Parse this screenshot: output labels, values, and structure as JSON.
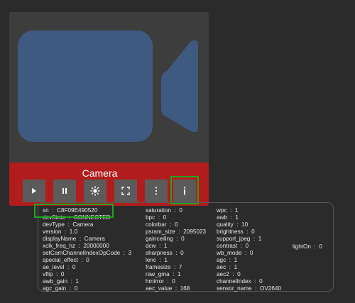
{
  "camera": {
    "title": "Camera"
  },
  "controls": {
    "play": "play-icon",
    "pause": "pause-icon",
    "brightness": "brightness-icon",
    "fullscreen": "fullscreen-icon",
    "menu": "more-vertical-icon",
    "info": "info-icon"
  },
  "info": {
    "columns": [
      [
        "sn  :  C8F09E490520",
        "devState  :  CONNECTED",
        "devType  :  Camera",
        "version  :  1.0",
        "displayName  :  Camera",
        "xclk_freq_hz  :  20000000",
        "setCamChannelIndexOpCode  :  3",
        "special_effect  :  0",
        "ae_level  :  0",
        "vflip  :  0",
        "awb_gain  :  1",
        "agc_gain  :  0"
      ],
      [
        "saturation  :  0",
        "bpc  :  0",
        "colorbar  :  0",
        "psram_size  :  2095023",
        "gainceiling  :  0",
        "dcw  :  1",
        "sharpness  :  0",
        "lenc  :  1",
        "framesize  :  7",
        "raw_gma  :  1",
        "hmirror  :  0",
        "aec_value  :  168"
      ],
      [
        "wpc  :  1",
        "awb  :  1",
        "quality  :  10",
        "brightness  :  0",
        "support_jpeg  :  1",
        "contrast  :  0",
        "wb_mode  :  0",
        "agc  :  1",
        "aec  :  1",
        "aec2  :  0",
        "channelIndex  :  0",
        "sensor_name  :  OV2640"
      ],
      [
        "lightOn  :  0"
      ]
    ]
  },
  "colors": {
    "background": "#2b2b2b",
    "card": "#3d3d3d",
    "camera_icon": "#3f5a80",
    "red_bar": "#b11c1c",
    "button": "#5b5b5b",
    "highlight": "#1fa51f"
  }
}
